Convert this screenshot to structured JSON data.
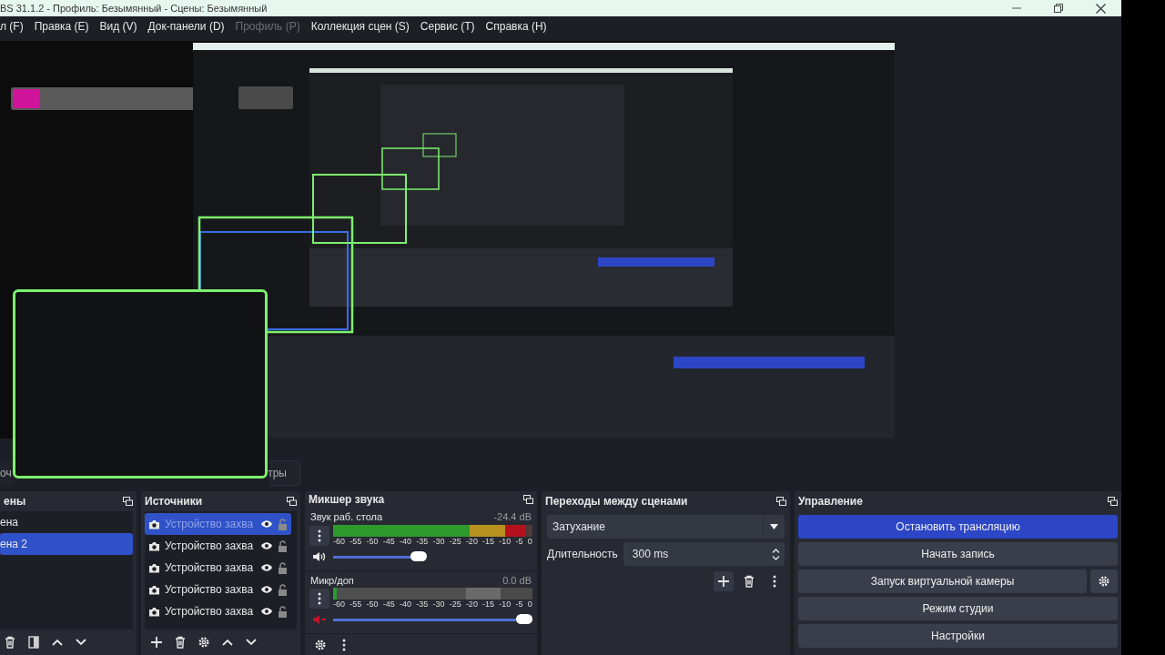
{
  "window": {
    "title": "BS 31.1.2 - Профиль: Безымянный - Сцены: Безымянный"
  },
  "menu": [
    {
      "label": "л (F)",
      "disabled": false
    },
    {
      "label": "Правка (E)",
      "disabled": false
    },
    {
      "label": "Вид (V)",
      "disabled": false
    },
    {
      "label": "Док-панели (D)",
      "disabled": false
    },
    {
      "label": "Профиль (P)",
      "disabled": true
    },
    {
      "label": "Коллекция сцен (S)",
      "disabled": false
    },
    {
      "label": "Сервис (T)",
      "disabled": false
    },
    {
      "label": "Справка (H)",
      "disabled": false
    }
  ],
  "context_bar": {
    "left": "оч",
    "right": "тры"
  },
  "scenes": {
    "title": "ены",
    "items": [
      {
        "label": "ена",
        "selected": false
      },
      {
        "label": "ена 2",
        "selected": true
      }
    ]
  },
  "sources": {
    "title": "Источники",
    "items": [
      {
        "label": "Устройство захва",
        "selected": true,
        "visible": true,
        "locked": false
      },
      {
        "label": "Устройство захва",
        "selected": false,
        "visible": true,
        "locked": false
      },
      {
        "label": "Устройство захва",
        "selected": false,
        "visible": true,
        "locked": false
      },
      {
        "label": "Устройство захва",
        "selected": false,
        "visible": true,
        "locked": false
      },
      {
        "label": "Устройство захва",
        "selected": false,
        "visible": true,
        "locked": false
      }
    ]
  },
  "mixer": {
    "title": "Микшер звука",
    "channels": [
      {
        "name": "Звук раб. стола",
        "reading": "-24.4 dB",
        "muted": false,
        "meter": {
          "level": 0.97
        },
        "volume": {
          "level": 0.43
        },
        "ticks": [
          "-60",
          "-55",
          "-50",
          "-45",
          "-40",
          "-35",
          "-30",
          "-25",
          "-20",
          "-15",
          "-10",
          "-5",
          "0"
        ]
      },
      {
        "name": "Микр/доп",
        "reading": "0.0 dB",
        "muted": true,
        "meter": {
          "level": 0.02
        },
        "volume": {
          "level": 1
        },
        "ticks": [
          "-60",
          "-55",
          "-50",
          "-45",
          "-40",
          "-35",
          "-30",
          "-25",
          "-20",
          "-15",
          "-10",
          "-5",
          "0"
        ]
      }
    ]
  },
  "transitions": {
    "title": "Переходы между сценами",
    "transition": "Затухание",
    "duration_label": "Длительность",
    "duration": "300 ms"
  },
  "controls": {
    "title": "Управление",
    "buttons": [
      {
        "label": "Остановить трансляцию",
        "active": true,
        "has_settings": false
      },
      {
        "label": "Начать запись",
        "active": false,
        "has_settings": false
      },
      {
        "label": "Запуск виртуальной камеры",
        "active": false,
        "has_settings": true
      },
      {
        "label": "Режим студии",
        "active": false,
        "has_settings": false
      },
      {
        "label": "Настройки",
        "active": false,
        "has_settings": false
      }
    ]
  }
}
